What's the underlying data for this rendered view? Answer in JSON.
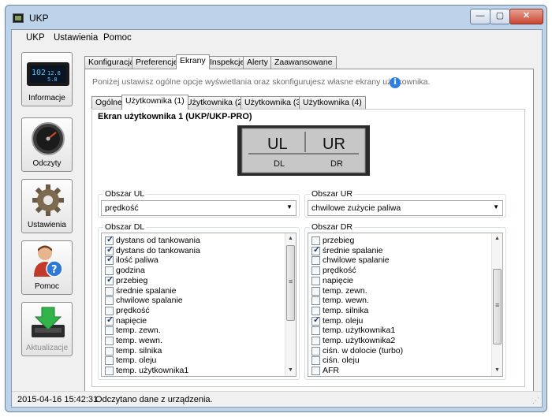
{
  "window": {
    "title": "UKP",
    "min_label": "—",
    "max_label": "▢",
    "close_label": "✕"
  },
  "menu": [
    "UKP",
    "Ustawienia",
    "Pomoc"
  ],
  "sidebar": [
    {
      "label": "Informacje",
      "icon": "display-icon",
      "disabled": false
    },
    {
      "label": "Odczyty",
      "icon": "gauge-icon",
      "disabled": false
    },
    {
      "label": "Ustawienia",
      "icon": "gear-icon",
      "disabled": false
    },
    {
      "label": "Pomoc",
      "icon": "help-person-icon",
      "disabled": false
    },
    {
      "label": "Aktualizacje",
      "icon": "download-icon",
      "disabled": true
    }
  ],
  "main_tabs": [
    "Konfiguracja",
    "Preferencje",
    "Ekrany",
    "Inspekcje",
    "Alerty",
    "Zaawansowane"
  ],
  "main_tab_active": "Ekrany",
  "hint": "Poniżej ustawisz ogólne opcje wyświetlania oraz skonfigurujesz własne ekrany użytkownika.",
  "sub_tabs": [
    "Ogólne",
    "Użytkownika (1)",
    "Użytkownika (2)",
    "Użytkownika (3)",
    "Użytkownika (4)"
  ],
  "sub_tab_active": "Użytkownika (1)",
  "screen": {
    "title": "Ekran użytkownika 1 (UKP/UKP-PRO)",
    "preview": {
      "ul": "UL",
      "ur": "UR",
      "dl": "DL",
      "dr": "DR"
    }
  },
  "obszar_ul": {
    "label": "Obszar UL",
    "value": "prędkość"
  },
  "obszar_ur": {
    "label": "Obszar UR",
    "value": "chwilowe zużycie paliwa"
  },
  "obszar_dl": {
    "label": "Obszar DL",
    "items": [
      {
        "text": "dystans od tankowania",
        "checked": true
      },
      {
        "text": "dystans do tankowania",
        "checked": true
      },
      {
        "text": "ilość paliwa",
        "checked": true
      },
      {
        "text": "godzina",
        "checked": false
      },
      {
        "text": "przebieg",
        "checked": true
      },
      {
        "text": "średnie spalanie",
        "checked": false
      },
      {
        "text": "chwilowe spalanie",
        "checked": false
      },
      {
        "text": "prędkość",
        "checked": false
      },
      {
        "text": "napięcie",
        "checked": true
      },
      {
        "text": "temp. zewn.",
        "checked": false
      },
      {
        "text": "temp. wewn.",
        "checked": false
      },
      {
        "text": "temp. silnika",
        "checked": false
      },
      {
        "text": "temp. oleju",
        "checked": false
      },
      {
        "text": "temp. użytkownika1",
        "checked": false
      }
    ]
  },
  "obszar_dr": {
    "label": "Obszar DR",
    "items": [
      {
        "text": "przebieg",
        "checked": false
      },
      {
        "text": "średnie spalanie",
        "checked": true
      },
      {
        "text": "chwilowe spalanie",
        "checked": false
      },
      {
        "text": "prędkość",
        "checked": false
      },
      {
        "text": "napięcie",
        "checked": false
      },
      {
        "text": "temp. zewn.",
        "checked": false
      },
      {
        "text": "temp. wewn.",
        "checked": false
      },
      {
        "text": "temp. silnika",
        "checked": false
      },
      {
        "text": "temp. oleju",
        "checked": true
      },
      {
        "text": "temp. użytkownika1",
        "checked": false
      },
      {
        "text": "temp. użytkownika2",
        "checked": false
      },
      {
        "text": "ciśn. w dolocie (turbo)",
        "checked": false
      },
      {
        "text": "ciśn. oleju",
        "checked": false
      },
      {
        "text": "AFR",
        "checked": false
      }
    ]
  },
  "status": {
    "timestamp": "2015-04-16 15:42:31",
    "message": "Odczytano dane z urządzenia."
  },
  "info_display_text": {
    "line1": "102",
    "line2": "12.8",
    "line3": "5.8"
  }
}
